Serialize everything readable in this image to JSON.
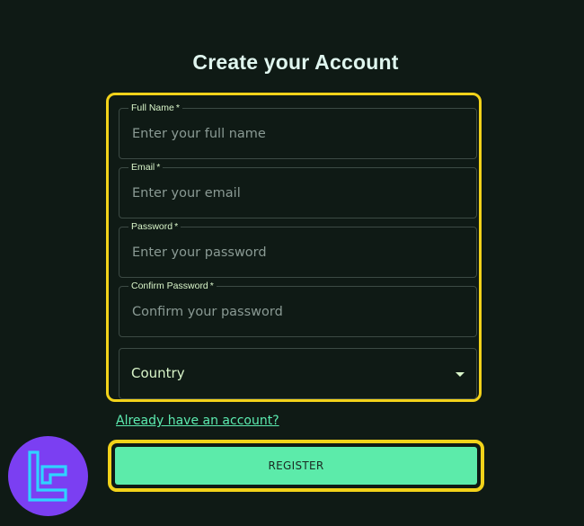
{
  "page": {
    "title": "Create your Account"
  },
  "form": {
    "fields": [
      {
        "label": "Full Name",
        "required_mark": "*",
        "placeholder": "Enter your full name",
        "value": ""
      },
      {
        "label": "Email",
        "required_mark": "*",
        "placeholder": "Enter your email",
        "value": ""
      },
      {
        "label": "Password",
        "required_mark": "*",
        "placeholder": "Enter your password",
        "value": ""
      },
      {
        "label": "Confirm Password",
        "required_mark": "*",
        "placeholder": "Confirm your password",
        "value": ""
      }
    ],
    "country_select": {
      "value": "Country",
      "icon": "chevron-down-icon"
    }
  },
  "links": {
    "login": "Already have an account?"
  },
  "actions": {
    "register_label": "REGISTER"
  },
  "logo": {
    "icon": "brand-logo-icon"
  },
  "colors": {
    "background": "#0f1a15",
    "highlight": "#f2d21a",
    "accent_green": "#5cebaa",
    "label_text": "#d9f5c9",
    "logo_purple": "#7b3ff2",
    "logo_cyan": "#2fd3ff"
  }
}
